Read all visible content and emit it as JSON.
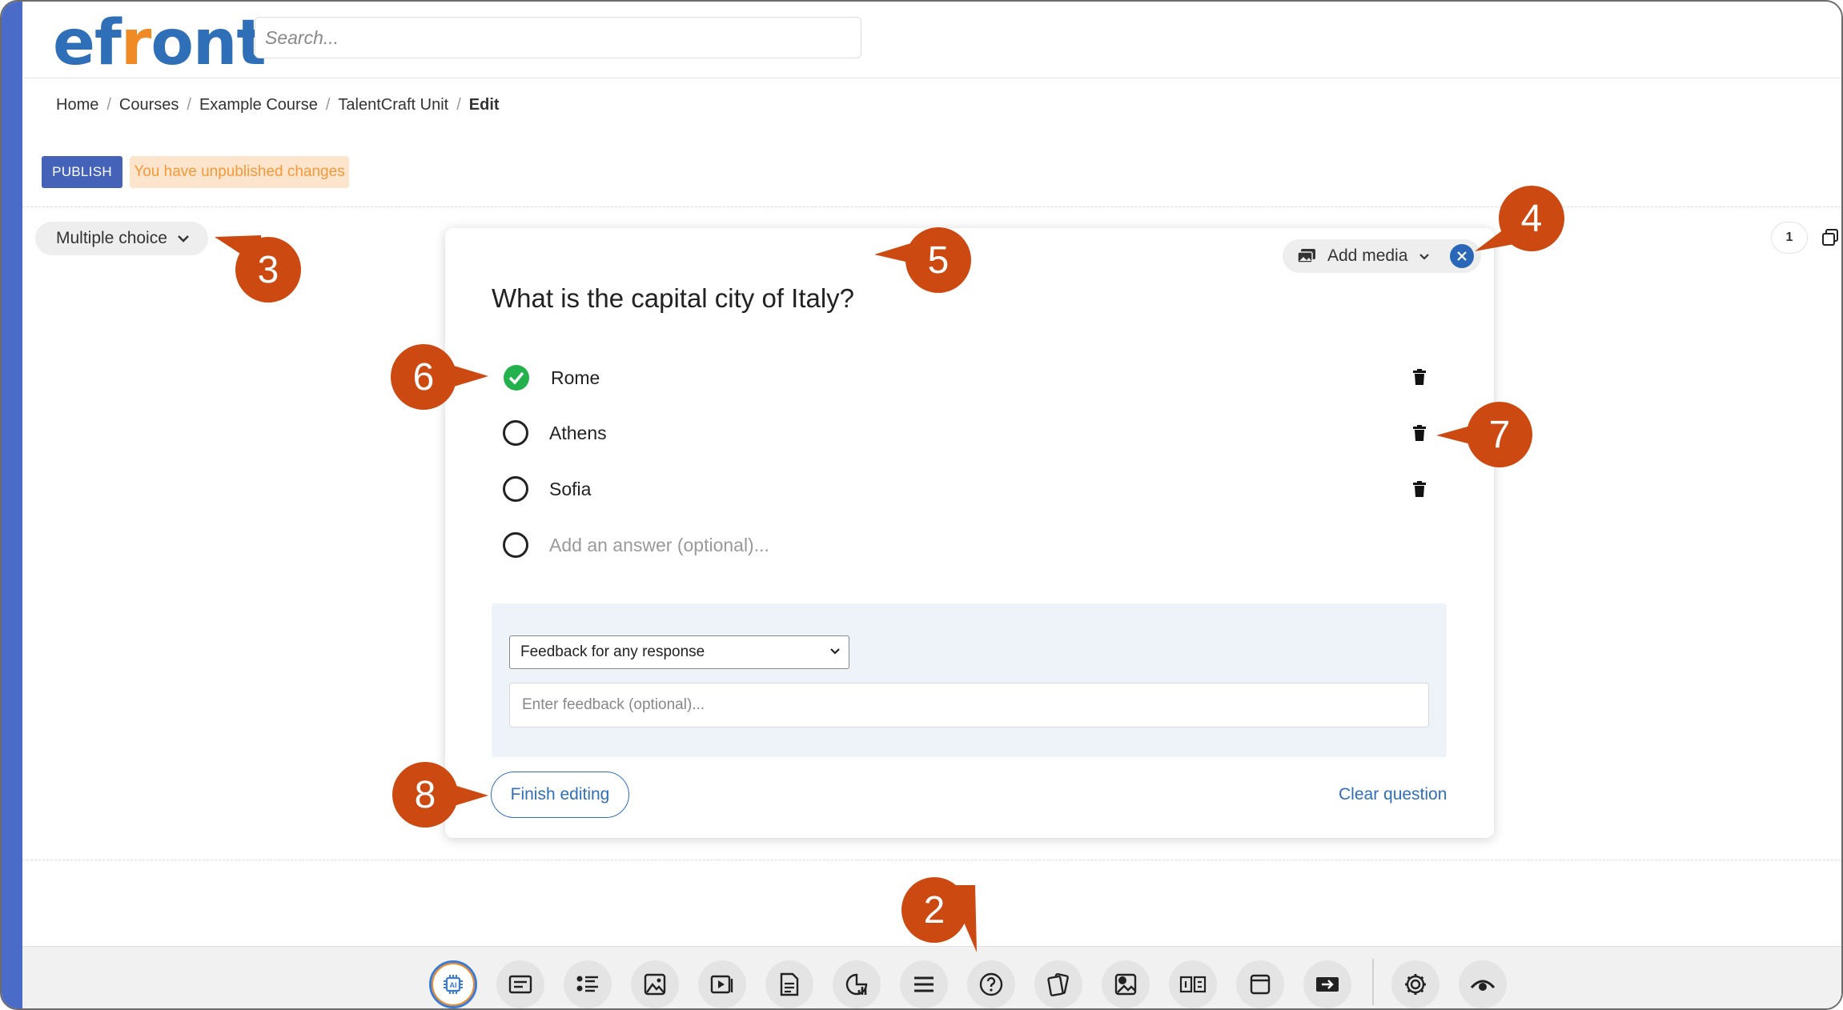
{
  "app": {
    "logo": "efront"
  },
  "header": {
    "search_placeholder": "Search..."
  },
  "breadcrumb": [
    "Home",
    "Courses",
    "Example Course",
    "TalentCraft Unit",
    "Edit"
  ],
  "breadcrumb_sep": "/",
  "actions": {
    "publish_label": "PUBLISH",
    "unpublished_notice": "You have unpublished changes"
  },
  "question_type": {
    "label": "Multiple choice",
    "icon": "chevron-down-icon"
  },
  "media": {
    "add_media_label": "Add media",
    "icon": "images-icon"
  },
  "question": {
    "text": "What is the capital city of Italy?",
    "answers": [
      {
        "text": "Rome",
        "correct": true
      },
      {
        "text": "Athens",
        "correct": false
      },
      {
        "text": "Sofia",
        "correct": false
      }
    ],
    "new_answer_placeholder": "Add an answer (optional)..."
  },
  "feedback": {
    "select_value": "Feedback for any response",
    "input_placeholder": "Enter feedback (optional)..."
  },
  "footer": {
    "finish_label": "Finish editing",
    "clear_label": "Clear question"
  },
  "page_count": "1",
  "toolbar_icons": [
    "ai-icon",
    "text-icon",
    "list-icon",
    "image-icon",
    "video-icon",
    "document-icon",
    "chart-icon",
    "divider-icon",
    "question-icon",
    "flashcards-icon",
    "image-hotspot-icon",
    "compare-icon",
    "window-icon",
    "embed-icon",
    "settings-icon",
    "preview-icon"
  ],
  "callouts": [
    "2",
    "3",
    "4",
    "5",
    "6",
    "7",
    "8"
  ],
  "colors": {
    "accent": "#2f6fb8",
    "logo_orange": "#f08a24",
    "publish": "#4462b8",
    "callout": "#cc4a12",
    "correct": "#22b14c"
  }
}
